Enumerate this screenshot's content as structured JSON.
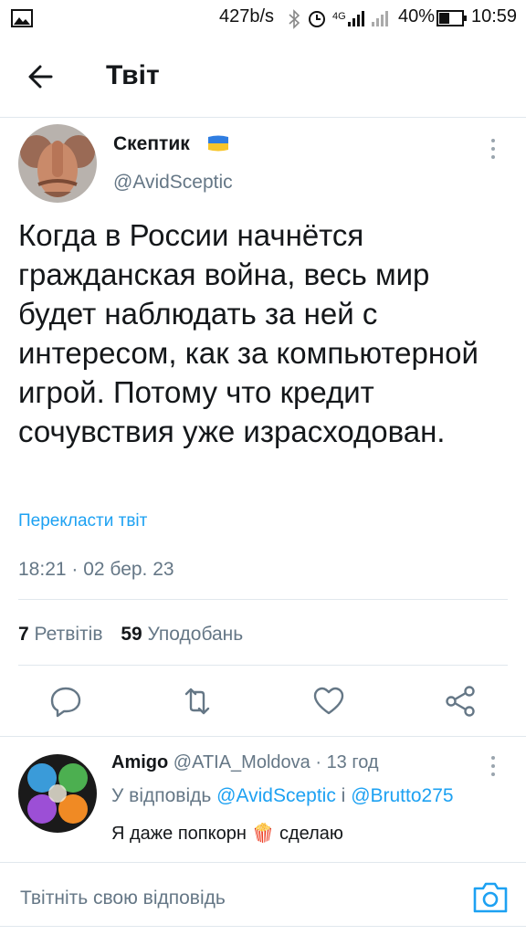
{
  "status_bar": {
    "speed": "427b/s",
    "network": "4G",
    "battery": "40%",
    "time": "10:59"
  },
  "header": {
    "title": "Твіт"
  },
  "tweet": {
    "author_name": "Скептик",
    "author_handle": "@AvidSceptic",
    "text": "Когда в России начнётся гражданская война, весь мир будет наблюдать за ней с интересом, как за компьютерной игрой. Потому что кредит сочувствия уже израсходован.",
    "translate_label": "Перекласти твіт",
    "timestamp": "18:21 · 02 бер. 23",
    "retweets_count": "7",
    "retweets_label": "Ретвітів",
    "likes_count": "59",
    "likes_label": "Уподобань"
  },
  "reply": {
    "author_name": "Amigo",
    "author_handle": "@ATIA_Moldova",
    "separator": " · ",
    "time_ago": "13 год",
    "reply_prefix": "У відповідь",
    "mention_1": "@AvidSceptic",
    "conjunction": "і",
    "mention_2": "@Brutto275",
    "text_before": "Я даже попкорн",
    "emoji": "🍿",
    "text_after": "сделаю"
  },
  "compose": {
    "placeholder": "Твітніть свою відповідь"
  },
  "colors": {
    "accent": "#1da1f2",
    "secondary_text": "#657786",
    "divider": "#e1e8ed"
  }
}
